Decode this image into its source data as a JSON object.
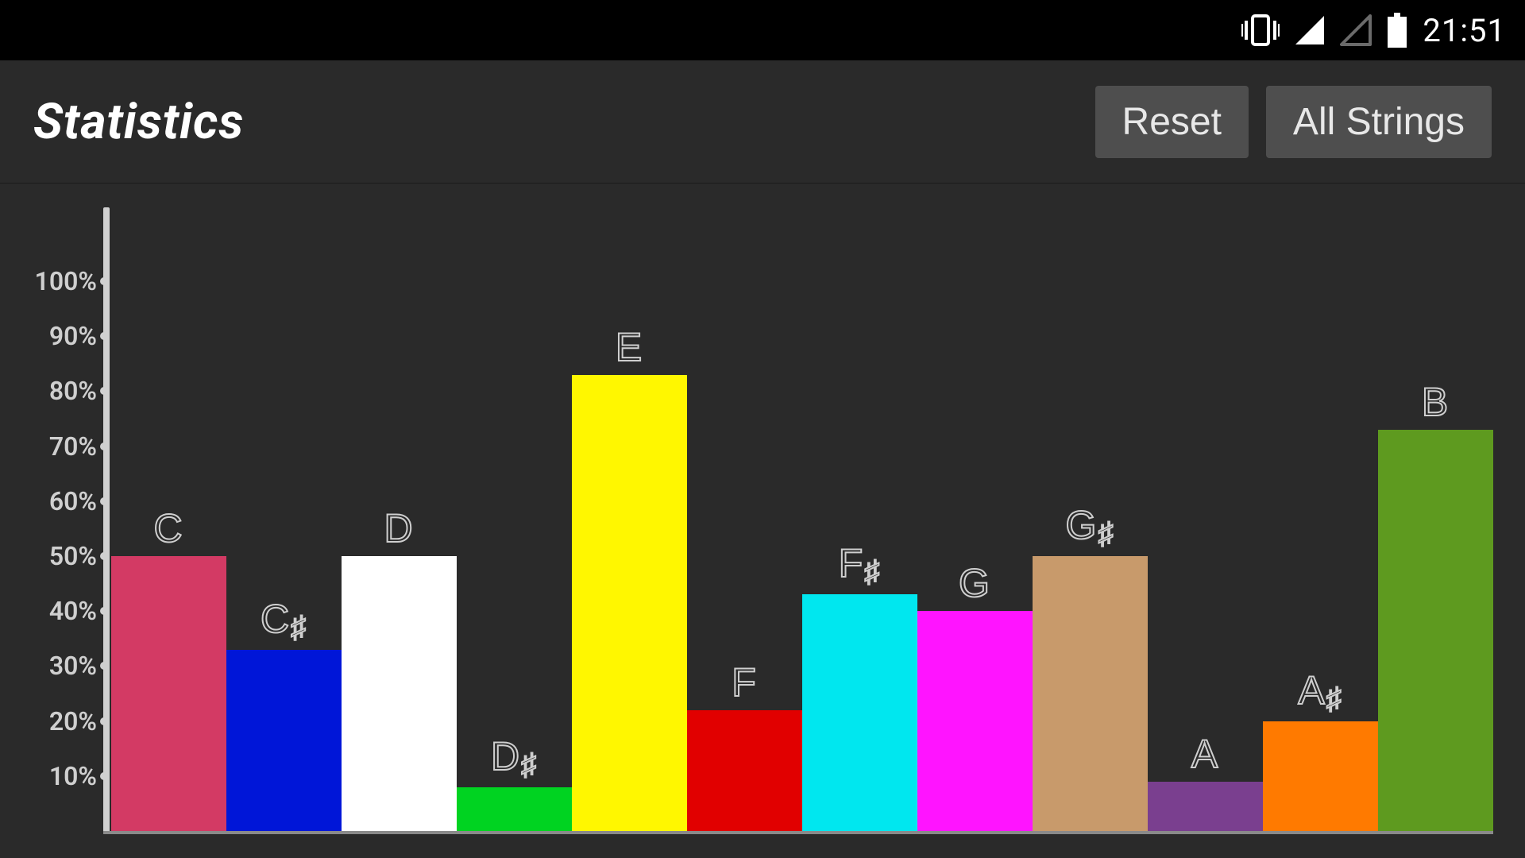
{
  "status_bar": {
    "time": "21:51"
  },
  "header": {
    "title": "Statistics",
    "reset_label": "Reset",
    "filter_label": "All Strings"
  },
  "chart_data": {
    "type": "bar",
    "title": "",
    "xlabel": "",
    "ylabel": "",
    "ylim": [
      0,
      100
    ],
    "y_ticks": [
      "10%",
      "20%",
      "30%",
      "40%",
      "50%",
      "60%",
      "70%",
      "80%",
      "90%",
      "100%"
    ],
    "categories": [
      "C",
      "C♯",
      "D",
      "D♯",
      "E",
      "F",
      "F♯",
      "G",
      "G♯",
      "A",
      "A♯",
      "B"
    ],
    "values": [
      50,
      33,
      50,
      8,
      83,
      22,
      43,
      40,
      50,
      9,
      20,
      73
    ],
    "colors": [
      "#d33a64",
      "#0016d8",
      "#ffffff",
      "#00d321",
      "#fff700",
      "#e10000",
      "#00e7ef",
      "#ff14ff",
      "#c89a6b",
      "#7a3f8f",
      "#ff7a00",
      "#5e9a1f"
    ]
  }
}
